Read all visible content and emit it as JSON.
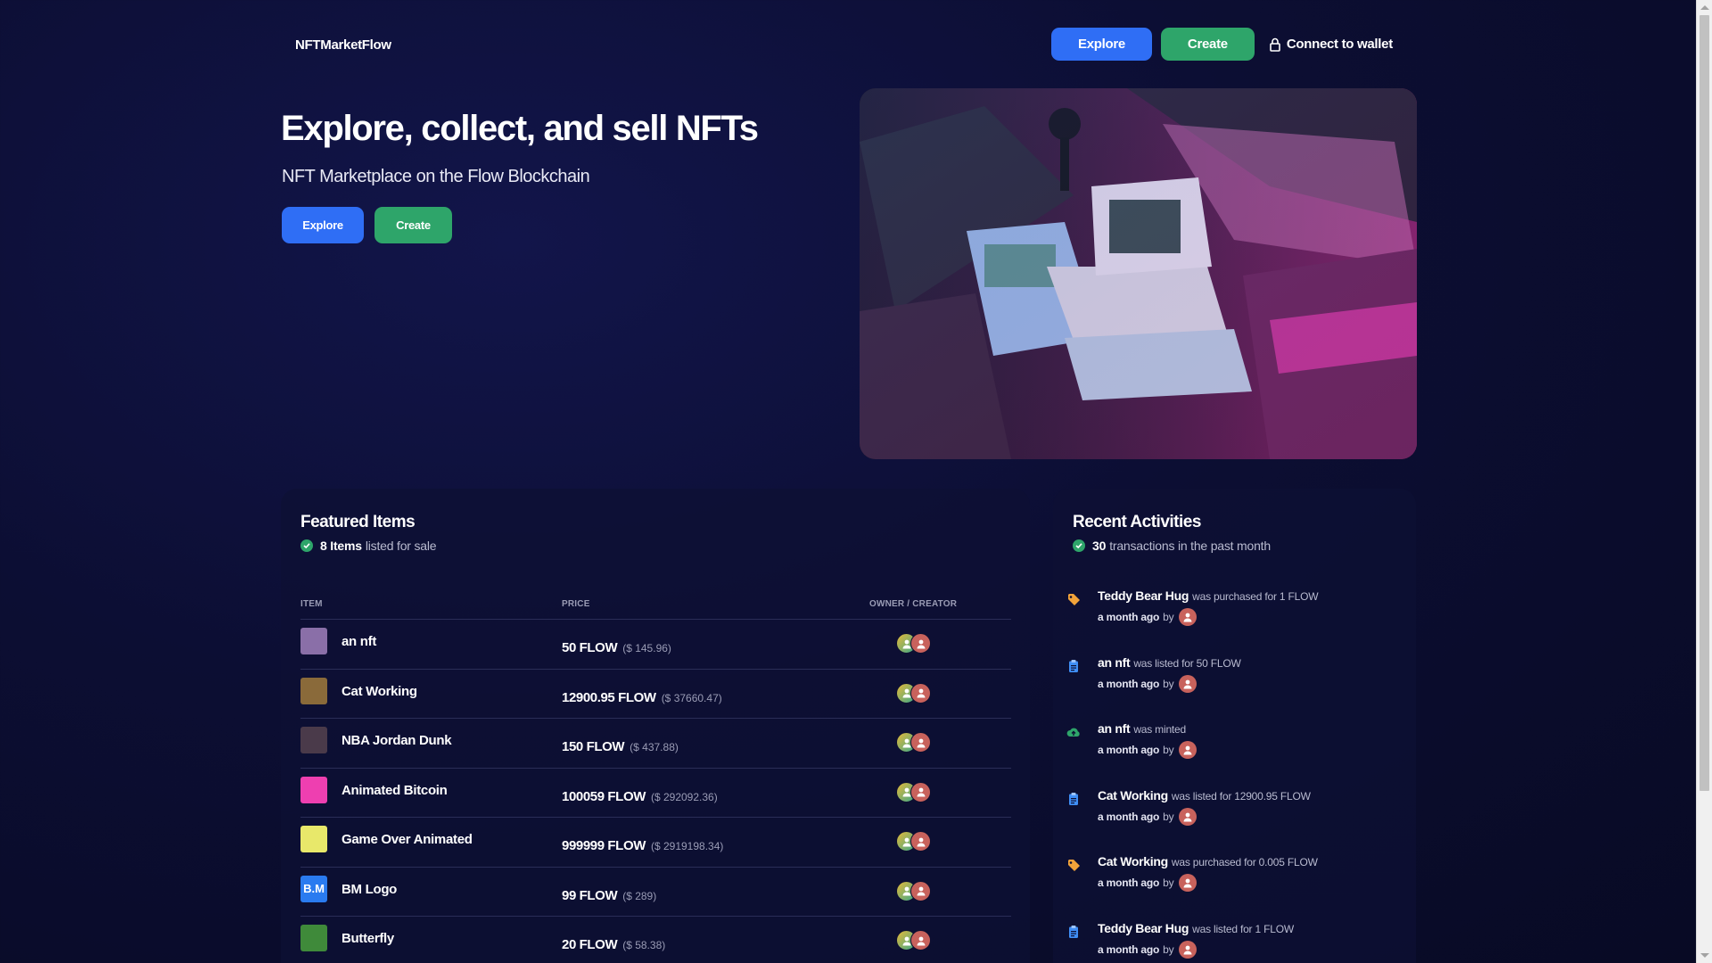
{
  "header": {
    "logo": "NFTMarketFlow",
    "nav": {
      "explore": "Explore",
      "create": "Create",
      "wallet": "Connect to wallet"
    }
  },
  "hero": {
    "title": "Explore, collect, and sell NFTs",
    "subtitle": "NFT Marketplace on the Flow Blockchain",
    "explore": "Explore",
    "create": "Create"
  },
  "featured": {
    "title": "Featured Items",
    "count": "8 Items",
    "count_suffix": "listed for sale",
    "columns": [
      "ITEM",
      "PRICE",
      "OWNER / CREATOR"
    ],
    "rows": [
      {
        "name": "an nft",
        "price": "50 FLOW",
        "usd": "($ 145.96)",
        "thumb_color": "#8a6fa8"
      },
      {
        "name": "Cat Working",
        "price": "12900.95 FLOW",
        "usd": "($ 37660.47)",
        "thumb_color": "#8a6a3a"
      },
      {
        "name": "NBA Jordan Dunk",
        "price": "150 FLOW",
        "usd": "($ 437.88)",
        "thumb_color": "#4a3a4a"
      },
      {
        "name": "Animated Bitcoin",
        "price": "100059 FLOW",
        "usd": "($ 292092.36)",
        "thumb_color": "#ee3fb0"
      },
      {
        "name": "Game Over Animated",
        "price": "999999 FLOW",
        "usd": "($ 2919198.34)",
        "thumb_color": "#e8e86a"
      },
      {
        "name": "BM Logo",
        "price": "99 FLOW",
        "usd": "($ 289)",
        "thumb_color": "#2a7bf0",
        "thumb_text": "B.M"
      },
      {
        "name": "Butterfly",
        "price": "20 FLOW",
        "usd": "($ 58.38)",
        "thumb_color": "#3f8a3a"
      }
    ]
  },
  "activity": {
    "title": "Recent Activities",
    "count": "30",
    "count_suffix": "transactions in the past month",
    "items": [
      {
        "icon": "tag-icon",
        "name": "Teddy Bear Hug",
        "action": "was purchased for 1 FLOW",
        "time": "a month ago",
        "by": "by"
      },
      {
        "icon": "clipboard-icon",
        "name": "an nft",
        "action": "was listed for 50 FLOW",
        "time": "a month ago",
        "by": "by"
      },
      {
        "icon": "cloud-upload-icon",
        "name": "an nft",
        "action": "was minted",
        "time": "a month ago",
        "by": "by"
      },
      {
        "icon": "clipboard-icon",
        "name": "Cat Working",
        "action": "was listed for 12900.95 FLOW",
        "time": "a month ago",
        "by": "by"
      },
      {
        "icon": "tag-icon",
        "name": "Cat Working",
        "action": "was purchased for 0.005 FLOW",
        "time": "a month ago",
        "by": "by"
      },
      {
        "icon": "clipboard-icon",
        "name": "Teddy Bear Hug",
        "action": "was listed for 1 FLOW",
        "time": "a month ago",
        "by": "by"
      }
    ]
  },
  "colors": {
    "primary": "#2f6ef5",
    "success": "#2ea56a",
    "background": "#0c0e33",
    "tag": "#f2a33a",
    "clipboard": "#3f8ef5"
  }
}
